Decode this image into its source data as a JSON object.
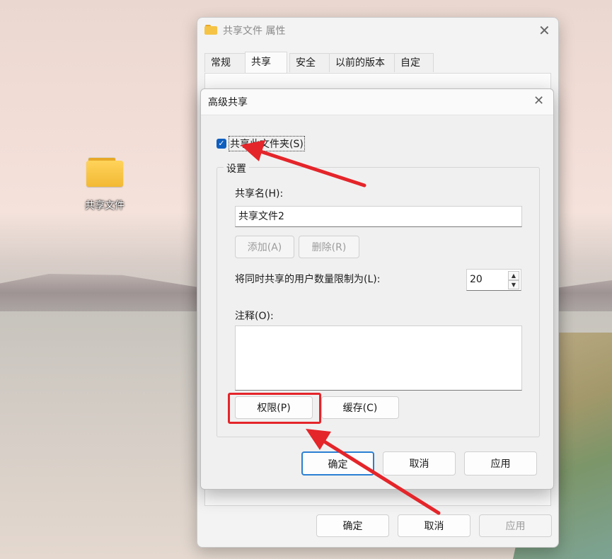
{
  "desktop": {
    "folder_label": "共享文件"
  },
  "properties_window": {
    "title": "共享文件 属性",
    "tabs": [
      {
        "label": "常规"
      },
      {
        "label": "共享"
      },
      {
        "label": "安全"
      },
      {
        "label": "以前的版本"
      },
      {
        "label": "自定义"
      }
    ],
    "buttons": {
      "ok": "确定",
      "cancel": "取消",
      "apply": "应用"
    }
  },
  "advanced_sharing": {
    "title": "高级共享",
    "share_checkbox": {
      "label": "共享此文件夹(S)",
      "checked": true
    },
    "settings_group": "设置",
    "share_name_label": "共享名(H):",
    "share_name_value": "共享文件2",
    "add_button": "添加(A)",
    "remove_button": "删除(R)",
    "user_limit_label": "将同时共享的用户数量限制为(L):",
    "user_limit_value": "20",
    "comment_label": "注释(O):",
    "comment_value": "",
    "permissions_button": "权限(P)",
    "caching_button": "缓存(C)",
    "ok_button": "确定",
    "cancel_button": "取消",
    "apply_button": "应用"
  },
  "colors": {
    "annotation": "#e4252a",
    "checkbox": "#0f5fbf"
  }
}
